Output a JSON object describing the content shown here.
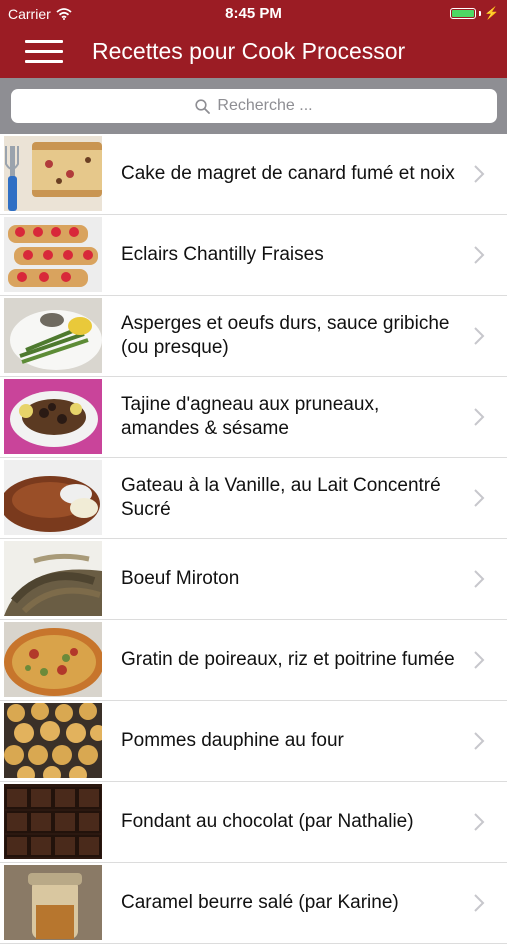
{
  "status": {
    "carrier": "Carrier",
    "time": "8:45 PM",
    "battery_level": 1.0
  },
  "nav": {
    "title": "Recettes pour Cook Processor"
  },
  "search": {
    "placeholder": "Recherche ..."
  },
  "colors": {
    "brand": "#9b1c24",
    "search_bar_bg": "#8e8e93",
    "chevron": "#c7c7cc",
    "battery": "#4cd964"
  },
  "recipes": [
    {
      "title": "Cake de magret de canard fumé et noix",
      "thumb_icon": "loaf-cake-image"
    },
    {
      "title": "Eclairs Chantilly Fraises",
      "thumb_icon": "eclairs-image"
    },
    {
      "title": "Asperges et oeufs durs, sauce gribiche (ou presque)",
      "thumb_icon": "asparagus-plate-image"
    },
    {
      "title": "Tajine d'agneau aux pruneaux, amandes & sésame",
      "thumb_icon": "tajine-image"
    },
    {
      "title": "Gateau à la Vanille,  au Lait Concentré Sucré",
      "thumb_icon": "bundt-cake-image"
    },
    {
      "title": "Boeuf Miroton",
      "thumb_icon": "beef-stew-image"
    },
    {
      "title": "Gratin de poireaux, riz et poitrine fumée",
      "thumb_icon": "gratin-image"
    },
    {
      "title": "Pommes dauphine au four",
      "thumb_icon": "puffs-image"
    },
    {
      "title": "Fondant au chocolat (par Nathalie)",
      "thumb_icon": "chocolate-bar-image"
    },
    {
      "title": "Caramel beurre salé (par Karine)",
      "thumb_icon": "caramel-jar-image"
    }
  ]
}
